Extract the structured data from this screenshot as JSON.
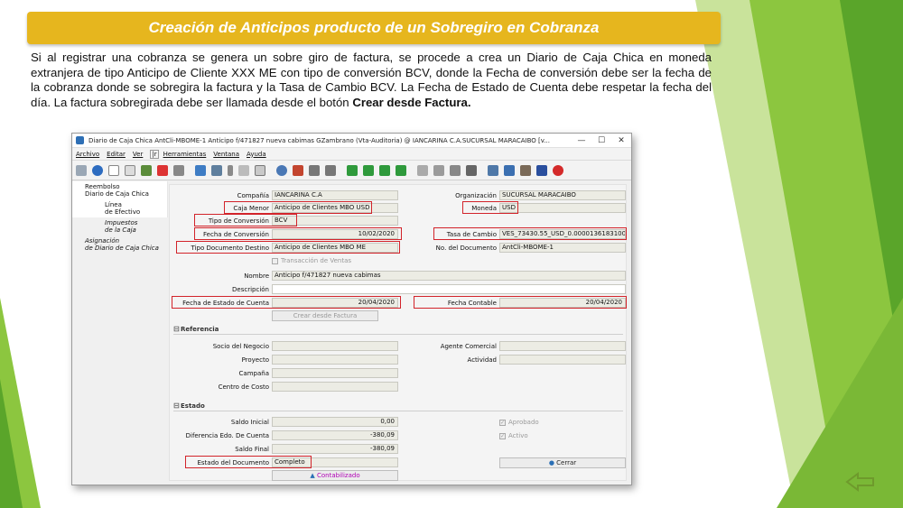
{
  "slide": {
    "title": "Creación de Anticipos producto de un Sobregiro en Cobranza",
    "paragraph_main": "Si al registrar una cobranza se genera un sobre giro de factura, se procede a crea un Diario de Caja Chica en moneda extranjera de tipo Anticipo de Cliente XXX ME con tipo de conversión BCV, donde la Fecha de conversión debe ser la fecha de la cobranza donde se sobregira la factura y la Tasa de Cambio BCV. La Fecha de Estado de Cuenta debe respetar la fecha del día. La factura sobregirada debe ser llamada desde el botón ",
    "paragraph_bold": "Crear desde Factura.",
    "back_icon": "back-arrow-icon"
  },
  "window": {
    "title": "Diario de Caja Chica  AntCli-MBOME-1  Anticipo f/471827 nueva cabimas  GZambrano (Vta-Auditoria) @ IANCARINA C.A.SUCURSAL MARACAIBO [v...",
    "controls": {
      "minimize": "—",
      "maximize": "☐",
      "close": "✕"
    },
    "menu": [
      "Archivo",
      "Editar",
      "Ver",
      "Herramientas",
      "Ventana",
      "Ayuda"
    ],
    "menu_sep": "|r"
  },
  "sidebar": {
    "items": [
      {
        "label": "Reembolso\nDiario de Caja Chica"
      },
      {
        "label": "Línea\nde Efectivo"
      },
      {
        "label": "Impuestos\nde la Caja"
      },
      {
        "label": "Asignación\nde Diario de Caja Chica"
      }
    ]
  },
  "form": {
    "compania_label": "Compañía",
    "compania": "IANCARINA C.A",
    "organizacion_label": "Organización",
    "organizacion": "SUCURSAL MARACAIBO",
    "caja_label": "Caja Menor",
    "caja": "Anticipo de Clientes MBO USD",
    "moneda_label": "Moneda",
    "moneda": "USD",
    "tipo_conv_label": "Tipo de Conversión",
    "tipo_conv": "BCV",
    "fecha_conv_label": "Fecha de Conversión",
    "fecha_conv": "10/02/2020",
    "tasa_label": "Tasa de Cambio",
    "tasa": "VES_73430.55_USD_0.0000136183100",
    "tipo_doc_label": "Tipo Documento Destino",
    "tipo_doc": "Anticipo de Clientes MBO ME",
    "nodoc_label": "No. del Documento",
    "nodoc": "AntCli-MBOME-1",
    "transaccion_label": "Transacción de Ventas",
    "nombre_label": "Nombre",
    "nombre": "Anticipo f/471827 nueva cabimas",
    "descripcion_label": "Descripción",
    "descripcion": "",
    "fecha_edo_label": "Fecha de Estado de Cuenta",
    "fecha_edo": "20/04/2020",
    "fecha_cont_label": "Fecha Contable",
    "fecha_cont": "20/04/2020",
    "crear_btn": "Crear desde Factura"
  },
  "referencia": {
    "title": "Referencia",
    "socio_label": "Socio del Negocio",
    "agente_label": "Agente Comercial",
    "proyecto_label": "Proyecto",
    "actividad_label": "Actividad",
    "campana_label": "Campaña",
    "centro_label": "Centro de Costo"
  },
  "estado": {
    "title": "Estado",
    "saldo_ini_label": "Saldo Inicial",
    "saldo_ini": "0,00",
    "aprobado_label": "Aprobado",
    "dif_label": "Diferencia Edo. De Cuenta",
    "dif": "-380,09",
    "activo_label": "Activo",
    "saldo_fin_label": "Saldo Final",
    "saldo_fin": "-380,09",
    "estado_doc_label": "Estado del Documento",
    "estado_doc": "Completo",
    "cerrar_btn": "Cerrar",
    "contabilizado_btn": "Contabilizado"
  },
  "colors": {
    "banner": "#e6b61e",
    "highlight": "#d2232a",
    "green_light": "#a6cf3a",
    "green_dark": "#4f9a22"
  }
}
